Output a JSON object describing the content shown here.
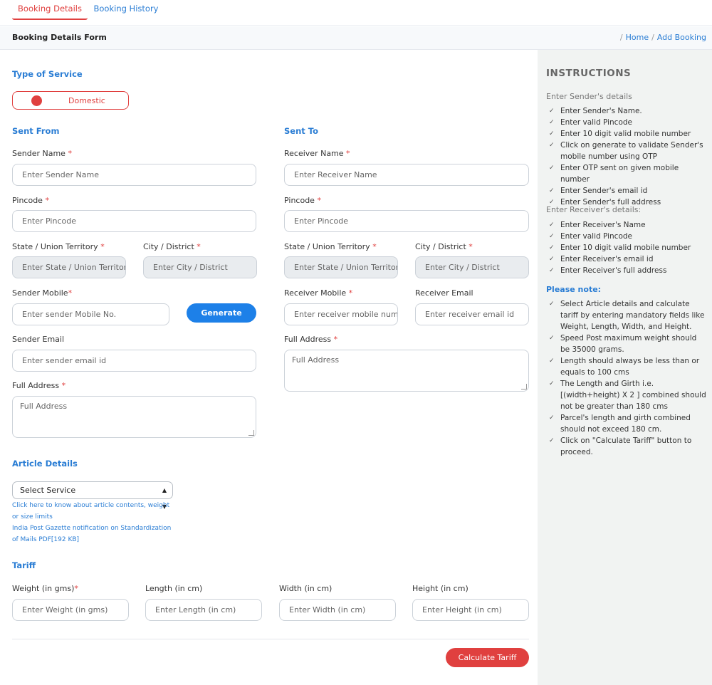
{
  "tabs": {
    "booking_details": "Booking Details",
    "booking_history": "Booking History"
  },
  "header": {
    "title": "Booking Details Form",
    "crumb_home": "Home",
    "crumb_current": "Add Booking"
  },
  "service": {
    "heading": "Type of Service",
    "toggle_label": "Domestic"
  },
  "sent_from": {
    "heading": "Sent From",
    "sender_name_label": "Sender Name",
    "sender_name_ph": "Enter Sender Name",
    "pincode_label": "Pincode",
    "pincode_ph": "Enter Pincode",
    "state_label": "State / Union Territory",
    "state_ph": "Enter State / Union Territory",
    "city_label": "City / District",
    "city_ph": "Enter City / District",
    "mobile_label": "Sender Mobile",
    "mobile_ph": "Enter sender Mobile No.",
    "generate_label": "Generate",
    "email_label": "Sender Email",
    "email_ph": "Enter sender email id",
    "address_label": "Full Address",
    "address_ph": "Full Address"
  },
  "sent_to": {
    "heading": "Sent To",
    "receiver_name_label": "Receiver Name",
    "receiver_name_ph": "Enter Receiver Name",
    "pincode_label": "Pincode",
    "pincode_ph": "Enter Pincode",
    "state_label": "State / Union Territory",
    "state_ph": "Enter State / Union Territory",
    "city_label": "City / District",
    "city_ph": "Enter City / District",
    "mobile_label": "Receiver Mobile",
    "mobile_ph": "Enter receiver mobile number",
    "email_label": "Receiver Email",
    "email_ph": "Enter receiver email id",
    "address_label": "Full Address",
    "address_ph": "Full Address"
  },
  "article": {
    "heading": "Article Details",
    "select_value": "Select Service",
    "link1": "Click here to know about article contents, weight or size limits",
    "link2": "India Post Gazette notification on Standardization of Mails PDF[192 KB]"
  },
  "tariff": {
    "heading": "Tariff",
    "weight_label": "Weight (in gms)",
    "weight_ph": "Enter Weight (in gms)",
    "length_label": "Length (in cm)",
    "length_ph": "Enter Length (in cm)",
    "width_label": "Width (in cm)",
    "width_ph": "Enter Width (in cm)",
    "height_label": "Height (in cm)",
    "height_ph": "Enter Height (in cm)",
    "calc_label": "Calculate Tariff"
  },
  "required_mark": "*",
  "instructions": {
    "title": "INSTRUCTIONS",
    "sender_heading": "Enter Sender's details",
    "sender_items": [
      "Enter Sender's Name.",
      "Enter valid Pincode",
      "Enter 10 digit valid mobile number",
      "Click on generate to validate Sender's mobile number using OTP",
      "Enter OTP sent on given mobile number",
      "Enter Sender's email id",
      "Enter Sender's full address"
    ],
    "receiver_heading": "Enter Receiver's details:",
    "receiver_items": [
      "Enter Receiver's Name",
      "Enter valid Pincode",
      "Enter 10 digit valid mobile number",
      "Enter Receiver's email id",
      "Enter Receiver's full address"
    ],
    "note_heading": "Please note:",
    "note_items": [
      "Select Article details and calculate tariff by entering mandatory fields like Weight, Length, Width, and Height.",
      "Speed Post maximum weight should be 35000 grams.",
      "Length should always be less than or equals to 100 cms",
      "The Length and Girth i.e. [(width+height) X 2 ] combined should not be greater than 180 cms",
      "Parcel's length and girth combined should not exceed 180 cm.",
      "Click on \"Calculate Tariff\" button to proceed."
    ]
  },
  "colors": {
    "accent_red": "#e0403f",
    "link_blue": "#2a7dd4",
    "button_blue": "#1d80e8"
  }
}
